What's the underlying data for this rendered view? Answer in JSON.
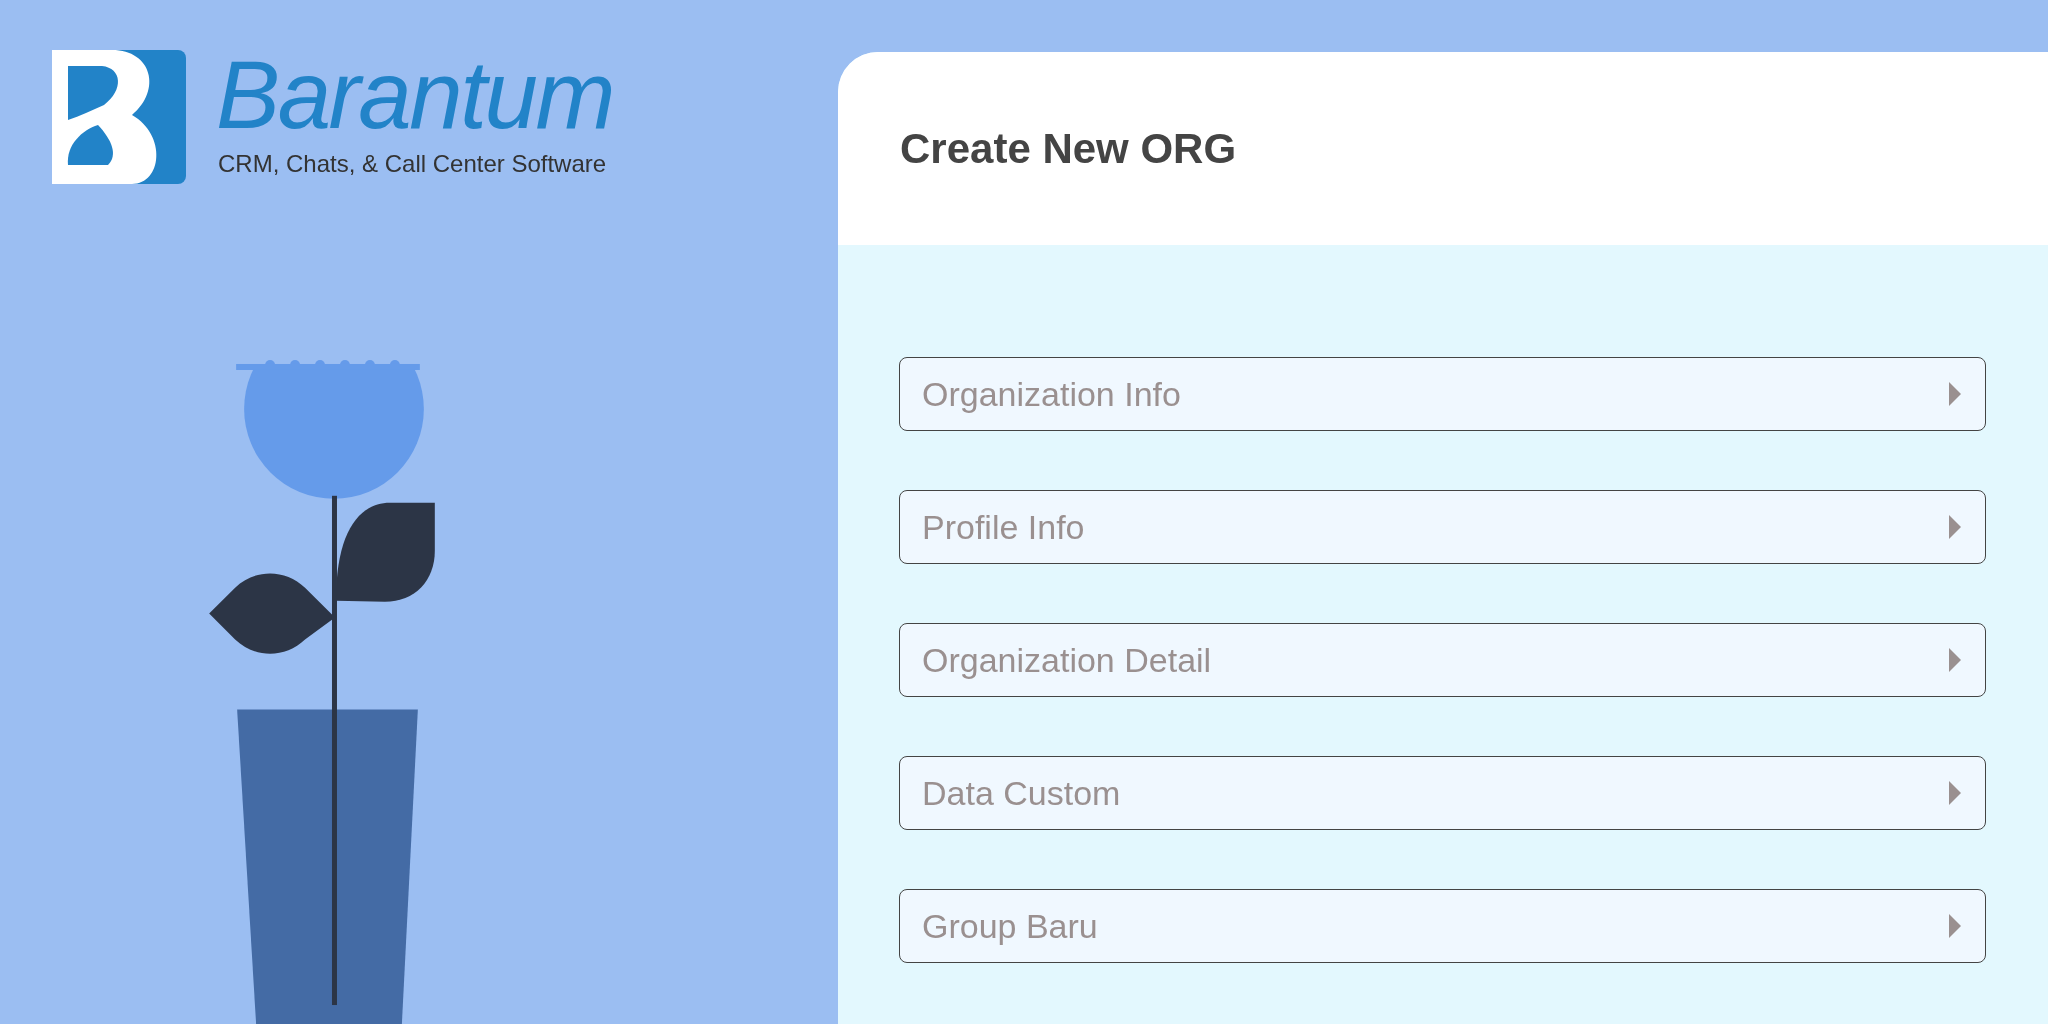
{
  "brand": {
    "name": "Barantum",
    "tagline": "CRM, Chats, & Call Center Software"
  },
  "form": {
    "title": "Create New ORG",
    "sections": [
      {
        "label": "Organization Info",
        "expanded": false
      },
      {
        "label": "Profile Info",
        "expanded": false
      },
      {
        "label": "Organization Detail",
        "expanded": false
      },
      {
        "label": "Data Custom",
        "expanded": false
      },
      {
        "label": "Group Baru",
        "expanded": false
      }
    ]
  }
}
